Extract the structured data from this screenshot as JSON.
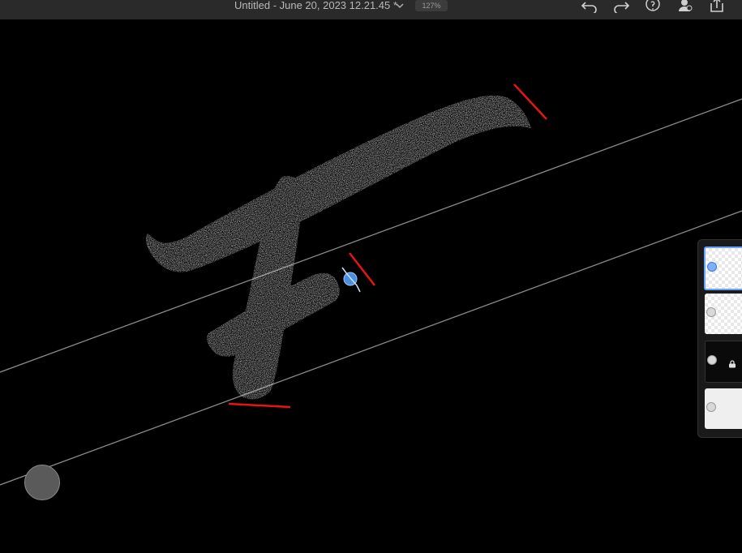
{
  "header": {
    "document_title": "Untitled - June 20, 2023 12.21.45 *",
    "zoom": "127%",
    "icons": [
      "undo-icon",
      "redo-icon",
      "help-icon",
      "account-icon",
      "share-icon"
    ]
  },
  "layers": {
    "count": 4,
    "items": [
      {
        "type": "transparent",
        "selected": true,
        "locked": false
      },
      {
        "type": "transparent",
        "selected": false,
        "locked": false
      },
      {
        "type": "dark",
        "selected": false,
        "locked": true
      },
      {
        "type": "background",
        "selected": false,
        "locked": false
      }
    ]
  },
  "colors": {
    "canvas": "#000000",
    "topbar": "#2a2a2a",
    "guide_line": "#8a8a8a",
    "stroke": "#ffffff",
    "marker": "#e81414",
    "cursor": "#4a8fe0"
  }
}
